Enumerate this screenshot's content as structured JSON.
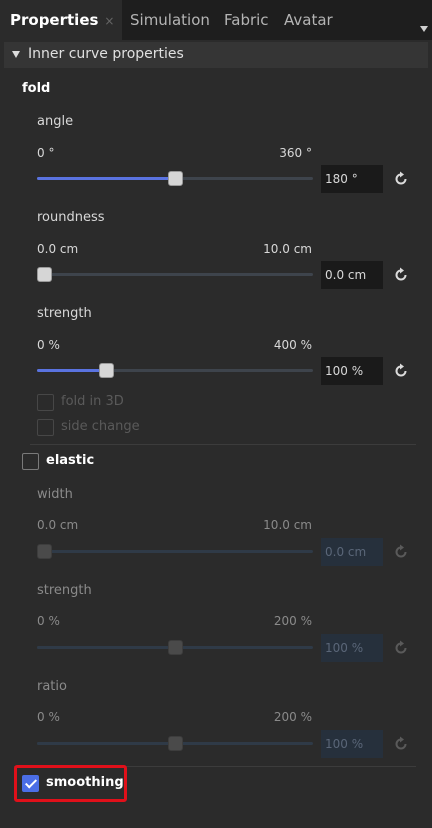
{
  "tabs": [
    {
      "label": "Properties",
      "close": "×"
    },
    {
      "label": "Simulation"
    },
    {
      "label": "Fabric"
    },
    {
      "label": "Avatar"
    }
  ],
  "section": {
    "title": "Inner curve properties"
  },
  "fold": {
    "title": "fold",
    "angle": {
      "label": "angle",
      "min": "0 °",
      "max": "360 °",
      "value": "180 °",
      "fraction": 0.5
    },
    "roundness": {
      "label": "roundness",
      "min": "0.0 cm",
      "max": "10.0 cm",
      "value": "0.0 cm",
      "fraction": 0.0
    },
    "strength": {
      "label": "strength",
      "min": "0 %",
      "max": "400 %",
      "value": "100 %",
      "fraction": 0.25
    },
    "fold_in_3d": {
      "label": "fold in 3D",
      "checked": false,
      "enabled": false
    },
    "side_change": {
      "label": "side change",
      "checked": false,
      "enabled": false
    }
  },
  "elastic": {
    "title": "elastic",
    "checked": false,
    "width": {
      "label": "width",
      "min": "0.0 cm",
      "max": "10.0 cm",
      "value": "0.0 cm",
      "fraction": 0.0
    },
    "strength": {
      "label": "strength",
      "min": "0 %",
      "max": "200 %",
      "value": "100 %",
      "fraction": 0.5
    },
    "ratio": {
      "label": "ratio",
      "min": "0 %",
      "max": "200 %",
      "value": "100 %",
      "fraction": 0.5
    }
  },
  "smoothing": {
    "label": "smoothing",
    "checked": true
  },
  "colors": {
    "accent": "#5a73e0",
    "checkbox": "#4b6ee6",
    "highlight": "#e0101a"
  },
  "icons": {
    "reset": "reset-icon",
    "collapse": "triangle-down-icon"
  }
}
